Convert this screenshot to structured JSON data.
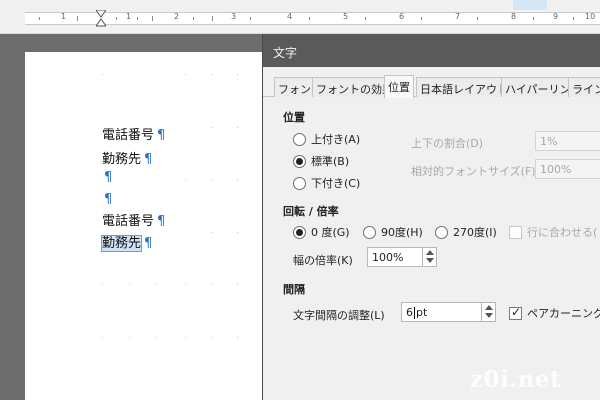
{
  "ruler": {
    "numbers": [
      "1",
      "1",
      "2",
      "3",
      "4",
      "5",
      "6",
      "7",
      "8",
      "9",
      "10"
    ]
  },
  "document": {
    "lines": [
      {
        "text": "電話番号",
        "pilcrow": "¶"
      },
      {
        "text": "勤務先",
        "pilcrow": "¶"
      },
      {
        "text": "",
        "pilcrow": "¶"
      },
      {
        "text": "",
        "pilcrow": "¶"
      },
      {
        "text": "電話番号",
        "pilcrow": "¶"
      },
      {
        "text": "勤務先",
        "pilcrow": "¶",
        "selected": true
      }
    ]
  },
  "dialog": {
    "title": "文字",
    "tabs": [
      {
        "label": "フォント",
        "active": false
      },
      {
        "label": "フォントの効果",
        "active": false
      },
      {
        "label": "位置",
        "active": true
      },
      {
        "label": "日本語レイアウト",
        "active": false
      },
      {
        "label": "ハイパーリンク",
        "active": false
      },
      {
        "label": "ライン",
        "active": false
      }
    ],
    "position": {
      "title": "位置",
      "options": [
        {
          "label": "上付き(A)",
          "checked": false
        },
        {
          "label": "標準(B)",
          "checked": true
        },
        {
          "label": "下付き(C)",
          "checked": false
        }
      ],
      "ratio_label": "上下の割合(D)",
      "ratio_value": "1%",
      "relative_size_label": "相対的フォントサイズ(F)",
      "relative_size_value": "100%"
    },
    "rotation": {
      "title": "回転 / 倍率",
      "options": [
        {
          "label": "0 度(G)",
          "checked": true
        },
        {
          "label": "90度(H)",
          "checked": false
        },
        {
          "label": "270度(I)",
          "checked": false
        }
      ],
      "fit_line_label": "行に合わせる(",
      "scale_label": "幅の倍率(K)",
      "scale_value": "100%"
    },
    "spacing": {
      "title": "間隔",
      "char_spacing_label": "文字間隔の調整(L)",
      "char_spacing_value_before": "6",
      "char_spacing_value_after": "pt",
      "pair_kerning_label": "ペアカーニング(M",
      "pair_kerning_checked": true
    }
  },
  "watermark": "z0i.net"
}
